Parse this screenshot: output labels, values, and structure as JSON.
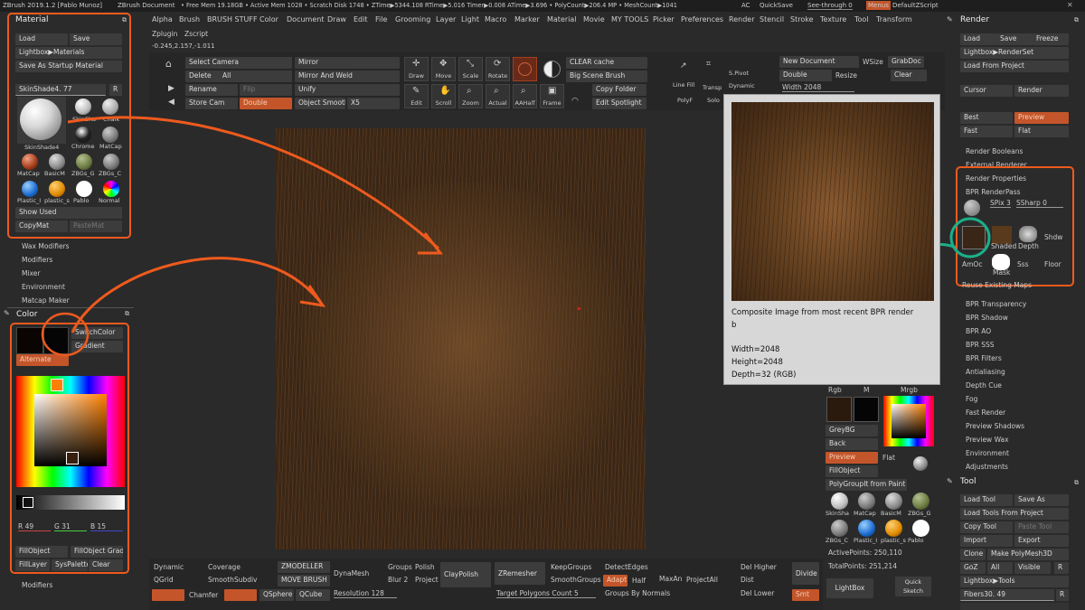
{
  "title_bar": {
    "app": "ZBrush 2019.1.2 [Pablo Munoz]",
    "doc": "ZBrush Document",
    "mem": "• Free Mem 19.18GB • Active Mem 1028 • Scratch Disk 1748 • ZTime▶5344.108 RTime▶5.016 Timer▶0.008 ATime▶3.696 • PolyCount▶206.4 MP • MeshCount▶1041",
    "ac": "AC",
    "quicksave": "QuickSave",
    "seethrough": "See-through 0",
    "menus": "Menus",
    "script": "DefaultZScript"
  },
  "menubar": [
    "Alpha",
    "Brush",
    "BRUSH STUFF",
    "Color",
    "Document",
    "Draw",
    "Edit",
    "File",
    "Grooming",
    "Layer",
    "Light",
    "Macro",
    "Marker",
    "Material",
    "Movie",
    "MY TOOLS",
    "Picker",
    "Preferences",
    "Render",
    "Stencil",
    "Stroke",
    "Texture",
    "Tool",
    "Transform"
  ],
  "menubar2": [
    "Zplugin",
    "Zscript"
  ],
  "coords": "-0.245,2.157,-1.011",
  "material": {
    "title": "Material",
    "load": "Load",
    "save": "Save",
    "lightbox": "Lightbox▶Materials",
    "save_startup": "Save As Startup Material",
    "current": "SkinShade4. 77",
    "r": "R",
    "big_label": "SkinShade4",
    "mats": [
      "SkinSha",
      "Chalk",
      "Chrome",
      "MatCap",
      "MatCap",
      "BasicM",
      "ZBGs_G",
      "ZBGs_C",
      "Plastic_I",
      "plastic_s",
      "Pablo",
      "Normal"
    ],
    "show_used": "Show Used",
    "copy": "CopyMat",
    "paste": "PasteMat"
  },
  "left_items": [
    "Wax Modifiers",
    "Modifiers",
    "Mixer",
    "Environment",
    "Matcap Maker"
  ],
  "color": {
    "title": "Color",
    "switch": "SwitchColor",
    "gradient": "Gradient",
    "alternate": "Alternate",
    "r": "R 49",
    "g": "G 31",
    "b": "B 15",
    "fillobject": "FillObject",
    "fillobject_grad": "FillObject Grad",
    "filllayer": "FillLayer",
    "syspalette": "SysPalette",
    "clear": "Clear"
  },
  "bottom_left": "Modifiers",
  "toolbar": {
    "select_camera": "Select Camera",
    "delete": "Delete",
    "all": "All",
    "rename": "Rename",
    "flip": "Flip",
    "store_cam": "Store Cam",
    "double": "Double",
    "mirror": "Mirror",
    "mirror_weld": "Mirror And Weld",
    "unify": "Unify",
    "object_smooth": "Object Smooth",
    "x5": "X5",
    "draw": "Draw",
    "move": "Move",
    "scale": "Scale",
    "rotate": "Rotate",
    "edit": "Edit",
    "scroll": "Scroll",
    "zoom": "Zoom",
    "actual": "Actual",
    "aahalf": "AAHalf",
    "frame": "Frame",
    "clear_cache": "CLEAR cache",
    "big_scene": "Big Scene Brush",
    "copy_folder": "Copy Folder",
    "edit_spotlight": "Edit Spotlight",
    "new_doc": "New Document",
    "wsize": "WSize",
    "grabdoc": "GrabDoc",
    "double2": "Double",
    "resize": "Resize",
    "clear": "Clear",
    "width": "Width 2048",
    "line_fill": "Line Fill",
    "polyf": "PolyF",
    "transp": "Transp",
    "solo": "Solo",
    "spivot": "S.Pivot",
    "dynamic": "Dynamic"
  },
  "popup": {
    "title": "Composite Image from most recent BPR render",
    "sub": "b",
    "width": "Width=2048",
    "height": "Height=2048",
    "depth": "Depth=32 (RGB)"
  },
  "mid_right": {
    "rgb": "Rgb",
    "m": "M",
    "mrgb": "Mrgb",
    "greybg": "GreyBG",
    "back": "Back",
    "preview": "Preview",
    "flat": "Flat",
    "fillobject": "FillObject",
    "polygroup": "PolyGroupIt from Paint",
    "mats": [
      "SkinSha",
      "MatCap",
      "BasicM",
      "ZBGs_G",
      "ZBGs_C",
      "Plastic_I",
      "plastic_s",
      "Pablo"
    ],
    "activepoints": "ActivePoints: 250,110",
    "totalpoints": "TotalPoints: 251,214",
    "lightbox": "LightBox",
    "quicksketch": "Quick Sketch"
  },
  "bottom": {
    "dynamic": "Dynamic",
    "coverage": "Coverage",
    "qgrid": "QGrid",
    "chamfer": "Chamfer",
    "smoothsubdiv": "SmoothSubdiv",
    "zmodeller": "ZMODELLER",
    "movebrush": "MOVE BRUSH",
    "qsphere": "QSphere",
    "qcube": "QCube",
    "dynamesh": "DynaMesh",
    "resolution": "Resolution 128",
    "groups": "Groups",
    "polish": "Polish",
    "blur": "Blur 2",
    "project": "Project",
    "claypolish": "ClayPolish",
    "zremesher": "ZRemesher",
    "target": "Target Polygons Count 5",
    "keepgroups": "KeepGroups",
    "smoothgroups": "SmoothGroups",
    "detectedges": "DetectEdges",
    "adapt": "Adapt",
    "half": "Half",
    "maxangle": "MaxAn",
    "groups_normals": "Groups By Normals",
    "projectall": "ProjectAll",
    "dist": "Dist",
    "del_higher": "Del Higher",
    "del_lower": "Del Lower",
    "divide": "Divide",
    "smt": "Smt"
  },
  "render": {
    "title": "Render",
    "load": "Load",
    "save": "Save",
    "freeze": "Freeze",
    "lightbox": "Lightbox▶RenderSet",
    "load_project": "Load From Project",
    "cursor": "Cursor",
    "render": "Render",
    "best": "Best",
    "preview": "Preview",
    "fast": "Fast",
    "flat": "Flat",
    "booleans": "Render Booleans",
    "external": "External Renderer",
    "properties": "Render Properties",
    "bpr_pass": "BPR RenderPass",
    "spix": "SPix 3",
    "ssharp": "SSharp 0",
    "passes": [
      "Shaded",
      "Depth",
      "Shdw",
      "AmOc",
      "Mask",
      "Sss",
      "Floor"
    ],
    "reuse": "Reuse Existing Maps",
    "items": [
      "BPR Transparency",
      "BPR Shadow",
      "BPR AO",
      "BPR SSS",
      "BPR Filters",
      "Antialiasing",
      "Depth Cue",
      "Fog",
      "Fast Render",
      "Preview Shadows",
      "Preview Wax",
      "Environment",
      "Adjustments"
    ]
  },
  "tool": {
    "title": "Tool",
    "load": "Load Tool",
    "saveas": "Save As",
    "load_project": "Load Tools From Project",
    "copy": "Copy Tool",
    "paste": "Paste Tool",
    "import": "Import",
    "export": "Export",
    "clone": "Clone",
    "make_polymesh": "Make PolyMesh3D",
    "goz": "GoZ",
    "all": "All",
    "visible": "Visible",
    "r": "R",
    "lightbox": "Lightbox▶Tools",
    "current": "Fibers30. 49"
  },
  "colors": {
    "accent": "#ee5a1e",
    "hot": "#c4552a",
    "teal": "#1bb08a",
    "canvas_bg": "#3a2616"
  }
}
